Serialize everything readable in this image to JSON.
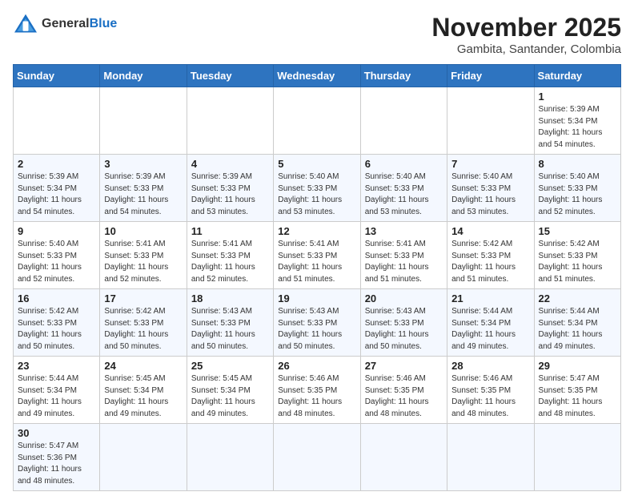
{
  "header": {
    "logo_general": "General",
    "logo_blue": "Blue",
    "month_title": "November 2025",
    "location": "Gambita, Santander, Colombia"
  },
  "weekdays": [
    "Sunday",
    "Monday",
    "Tuesday",
    "Wednesday",
    "Thursday",
    "Friday",
    "Saturday"
  ],
  "weeks": [
    [
      {
        "day": "",
        "info": ""
      },
      {
        "day": "",
        "info": ""
      },
      {
        "day": "",
        "info": ""
      },
      {
        "day": "",
        "info": ""
      },
      {
        "day": "",
        "info": ""
      },
      {
        "day": "",
        "info": ""
      },
      {
        "day": "1",
        "info": "Sunrise: 5:39 AM\nSunset: 5:34 PM\nDaylight: 11 hours\nand 54 minutes."
      }
    ],
    [
      {
        "day": "2",
        "info": "Sunrise: 5:39 AM\nSunset: 5:34 PM\nDaylight: 11 hours\nand 54 minutes."
      },
      {
        "day": "3",
        "info": "Sunrise: 5:39 AM\nSunset: 5:33 PM\nDaylight: 11 hours\nand 54 minutes."
      },
      {
        "day": "4",
        "info": "Sunrise: 5:39 AM\nSunset: 5:33 PM\nDaylight: 11 hours\nand 53 minutes."
      },
      {
        "day": "5",
        "info": "Sunrise: 5:40 AM\nSunset: 5:33 PM\nDaylight: 11 hours\nand 53 minutes."
      },
      {
        "day": "6",
        "info": "Sunrise: 5:40 AM\nSunset: 5:33 PM\nDaylight: 11 hours\nand 53 minutes."
      },
      {
        "day": "7",
        "info": "Sunrise: 5:40 AM\nSunset: 5:33 PM\nDaylight: 11 hours\nand 53 minutes."
      },
      {
        "day": "8",
        "info": "Sunrise: 5:40 AM\nSunset: 5:33 PM\nDaylight: 11 hours\nand 52 minutes."
      }
    ],
    [
      {
        "day": "9",
        "info": "Sunrise: 5:40 AM\nSunset: 5:33 PM\nDaylight: 11 hours\nand 52 minutes."
      },
      {
        "day": "10",
        "info": "Sunrise: 5:41 AM\nSunset: 5:33 PM\nDaylight: 11 hours\nand 52 minutes."
      },
      {
        "day": "11",
        "info": "Sunrise: 5:41 AM\nSunset: 5:33 PM\nDaylight: 11 hours\nand 52 minutes."
      },
      {
        "day": "12",
        "info": "Sunrise: 5:41 AM\nSunset: 5:33 PM\nDaylight: 11 hours\nand 51 minutes."
      },
      {
        "day": "13",
        "info": "Sunrise: 5:41 AM\nSunset: 5:33 PM\nDaylight: 11 hours\nand 51 minutes."
      },
      {
        "day": "14",
        "info": "Sunrise: 5:42 AM\nSunset: 5:33 PM\nDaylight: 11 hours\nand 51 minutes."
      },
      {
        "day": "15",
        "info": "Sunrise: 5:42 AM\nSunset: 5:33 PM\nDaylight: 11 hours\nand 51 minutes."
      }
    ],
    [
      {
        "day": "16",
        "info": "Sunrise: 5:42 AM\nSunset: 5:33 PM\nDaylight: 11 hours\nand 50 minutes."
      },
      {
        "day": "17",
        "info": "Sunrise: 5:42 AM\nSunset: 5:33 PM\nDaylight: 11 hours\nand 50 minutes."
      },
      {
        "day": "18",
        "info": "Sunrise: 5:43 AM\nSunset: 5:33 PM\nDaylight: 11 hours\nand 50 minutes."
      },
      {
        "day": "19",
        "info": "Sunrise: 5:43 AM\nSunset: 5:33 PM\nDaylight: 11 hours\nand 50 minutes."
      },
      {
        "day": "20",
        "info": "Sunrise: 5:43 AM\nSunset: 5:33 PM\nDaylight: 11 hours\nand 50 minutes."
      },
      {
        "day": "21",
        "info": "Sunrise: 5:44 AM\nSunset: 5:34 PM\nDaylight: 11 hours\nand 49 minutes."
      },
      {
        "day": "22",
        "info": "Sunrise: 5:44 AM\nSunset: 5:34 PM\nDaylight: 11 hours\nand 49 minutes."
      }
    ],
    [
      {
        "day": "23",
        "info": "Sunrise: 5:44 AM\nSunset: 5:34 PM\nDaylight: 11 hours\nand 49 minutes."
      },
      {
        "day": "24",
        "info": "Sunrise: 5:45 AM\nSunset: 5:34 PM\nDaylight: 11 hours\nand 49 minutes."
      },
      {
        "day": "25",
        "info": "Sunrise: 5:45 AM\nSunset: 5:34 PM\nDaylight: 11 hours\nand 49 minutes."
      },
      {
        "day": "26",
        "info": "Sunrise: 5:46 AM\nSunset: 5:35 PM\nDaylight: 11 hours\nand 48 minutes."
      },
      {
        "day": "27",
        "info": "Sunrise: 5:46 AM\nSunset: 5:35 PM\nDaylight: 11 hours\nand 48 minutes."
      },
      {
        "day": "28",
        "info": "Sunrise: 5:46 AM\nSunset: 5:35 PM\nDaylight: 11 hours\nand 48 minutes."
      },
      {
        "day": "29",
        "info": "Sunrise: 5:47 AM\nSunset: 5:35 PM\nDaylight: 11 hours\nand 48 minutes."
      }
    ],
    [
      {
        "day": "30",
        "info": "Sunrise: 5:47 AM\nSunset: 5:36 PM\nDaylight: 11 hours\nand 48 minutes."
      },
      {
        "day": "",
        "info": ""
      },
      {
        "day": "",
        "info": ""
      },
      {
        "day": "",
        "info": ""
      },
      {
        "day": "",
        "info": ""
      },
      {
        "day": "",
        "info": ""
      },
      {
        "day": "",
        "info": ""
      }
    ]
  ]
}
